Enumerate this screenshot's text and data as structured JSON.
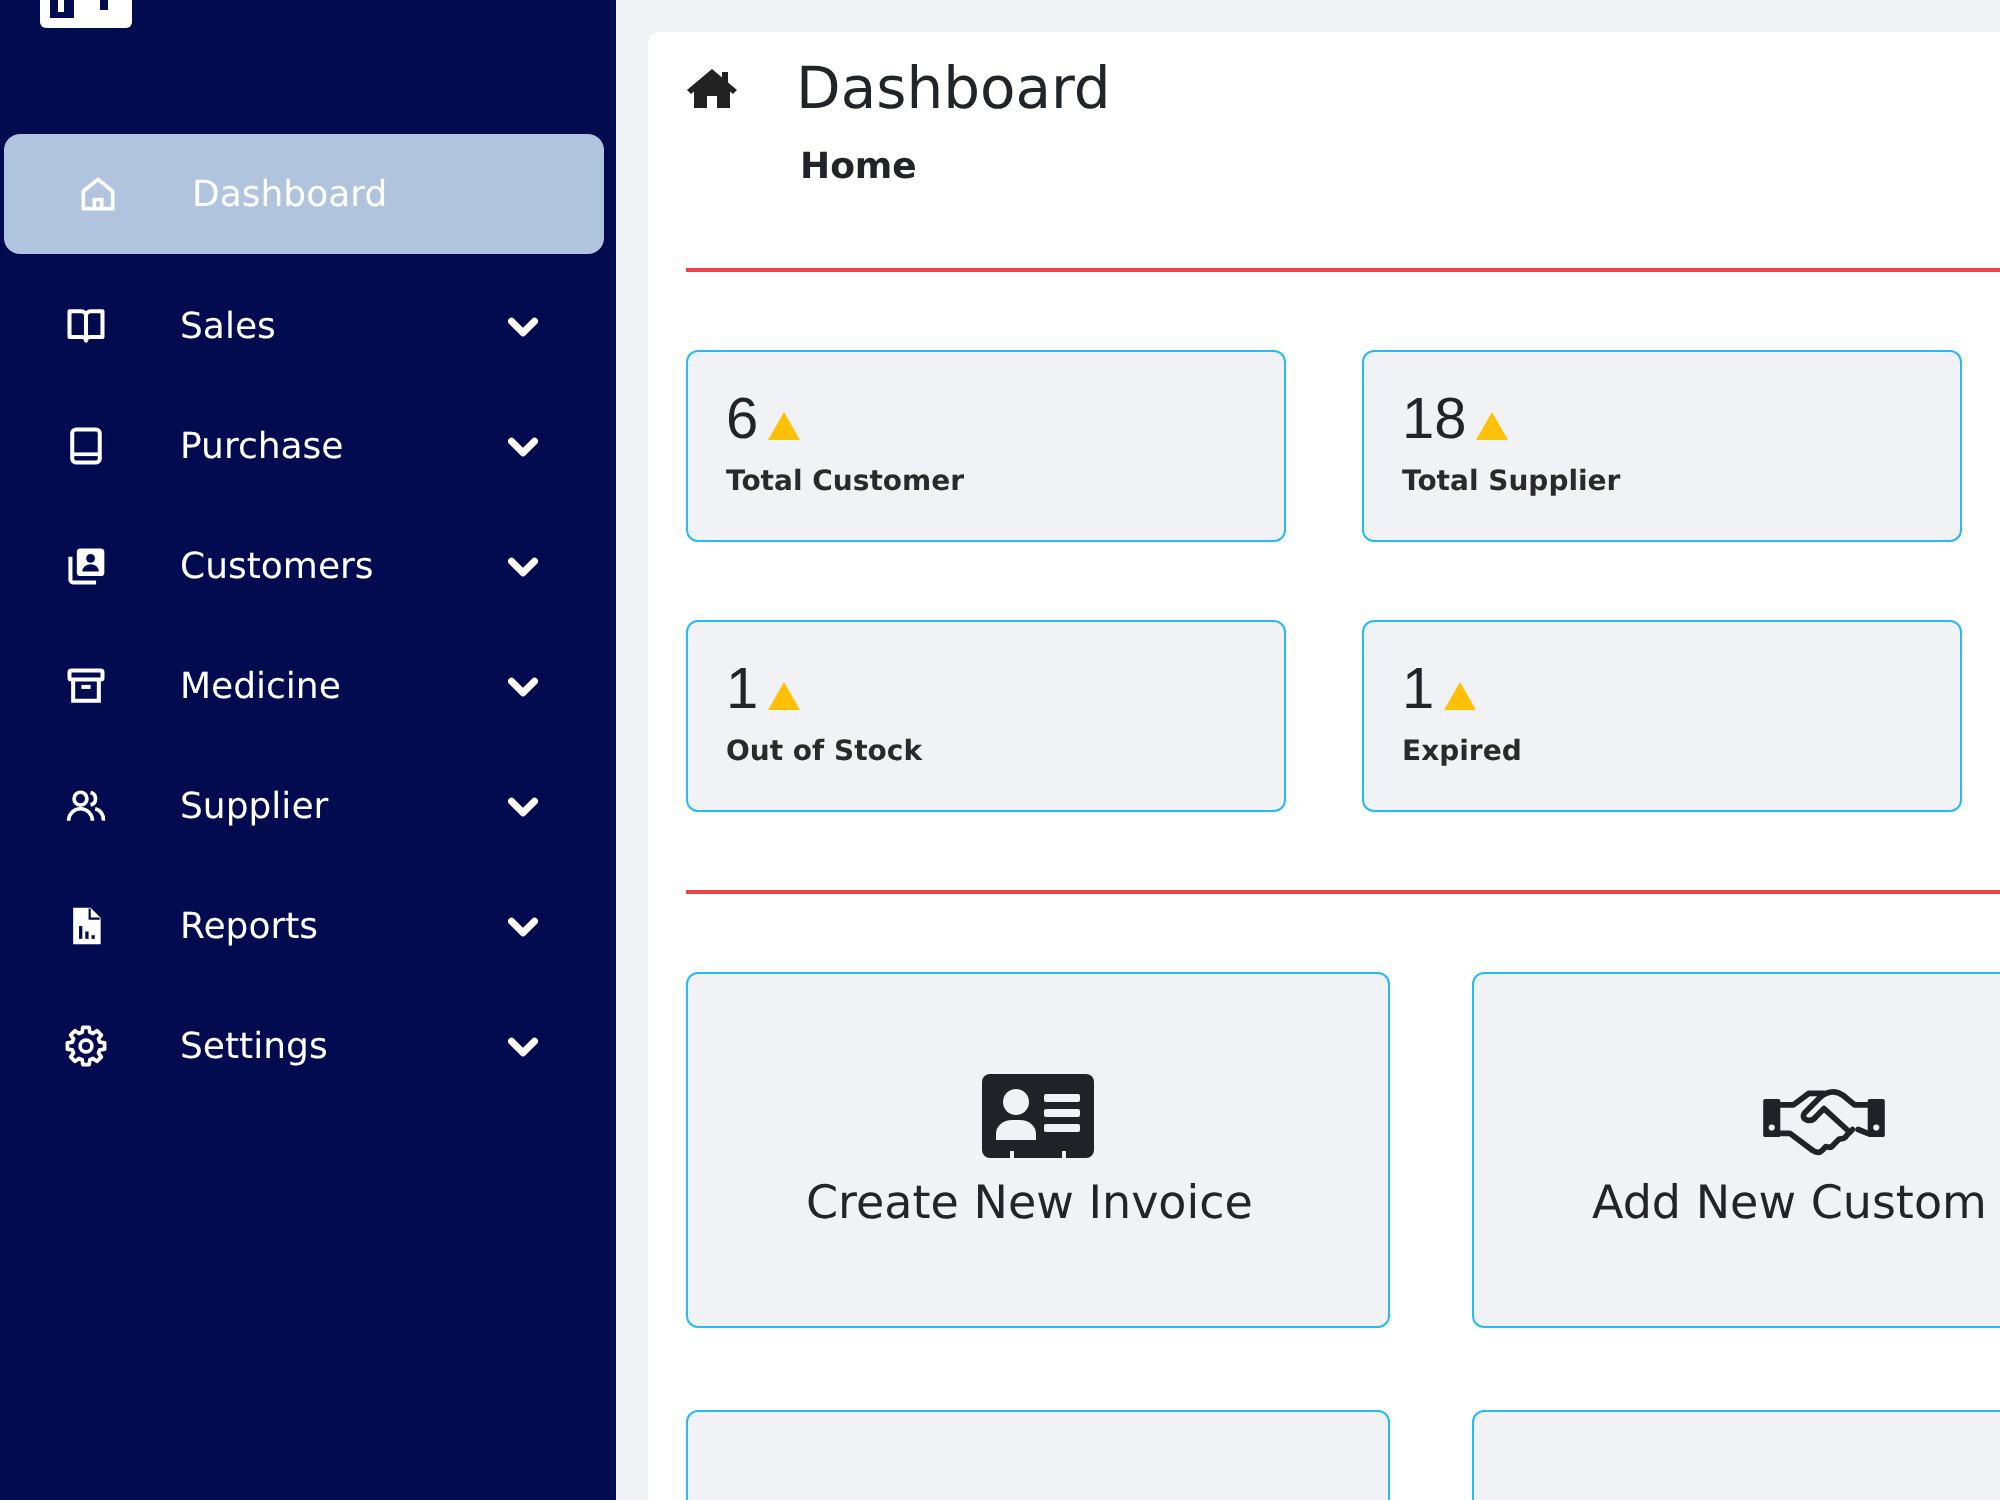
{
  "sidebar": {
    "items": [
      {
        "label": "Dashboard",
        "kind": "link",
        "selected": true
      },
      {
        "label": "Sales",
        "kind": "menu",
        "selected": false
      },
      {
        "label": "Purchase",
        "kind": "menu",
        "selected": false
      },
      {
        "label": "Customers",
        "kind": "menu",
        "selected": false
      },
      {
        "label": "Medicine",
        "kind": "menu",
        "selected": false
      },
      {
        "label": "Supplier",
        "kind": "menu",
        "selected": false
      },
      {
        "label": "Reports",
        "kind": "menu",
        "selected": false
      },
      {
        "label": "Settings",
        "kind": "menu",
        "selected": false
      }
    ]
  },
  "header": {
    "title": "Dashboard",
    "breadcrumb": "Home"
  },
  "stats": [
    {
      "value": "6",
      "label": "Total Customer"
    },
    {
      "value": "18",
      "label": "Total Supplier"
    },
    {
      "value": "1",
      "label": "Out of Stock"
    },
    {
      "value": "1",
      "label": "Expired"
    }
  ],
  "actions": [
    {
      "kind": "invoice",
      "label": "Create New Invoice"
    },
    {
      "kind": "customer",
      "label": "Add New Custom"
    },
    {
      "kind": "blank"
    },
    {
      "kind": "blank"
    }
  ]
}
